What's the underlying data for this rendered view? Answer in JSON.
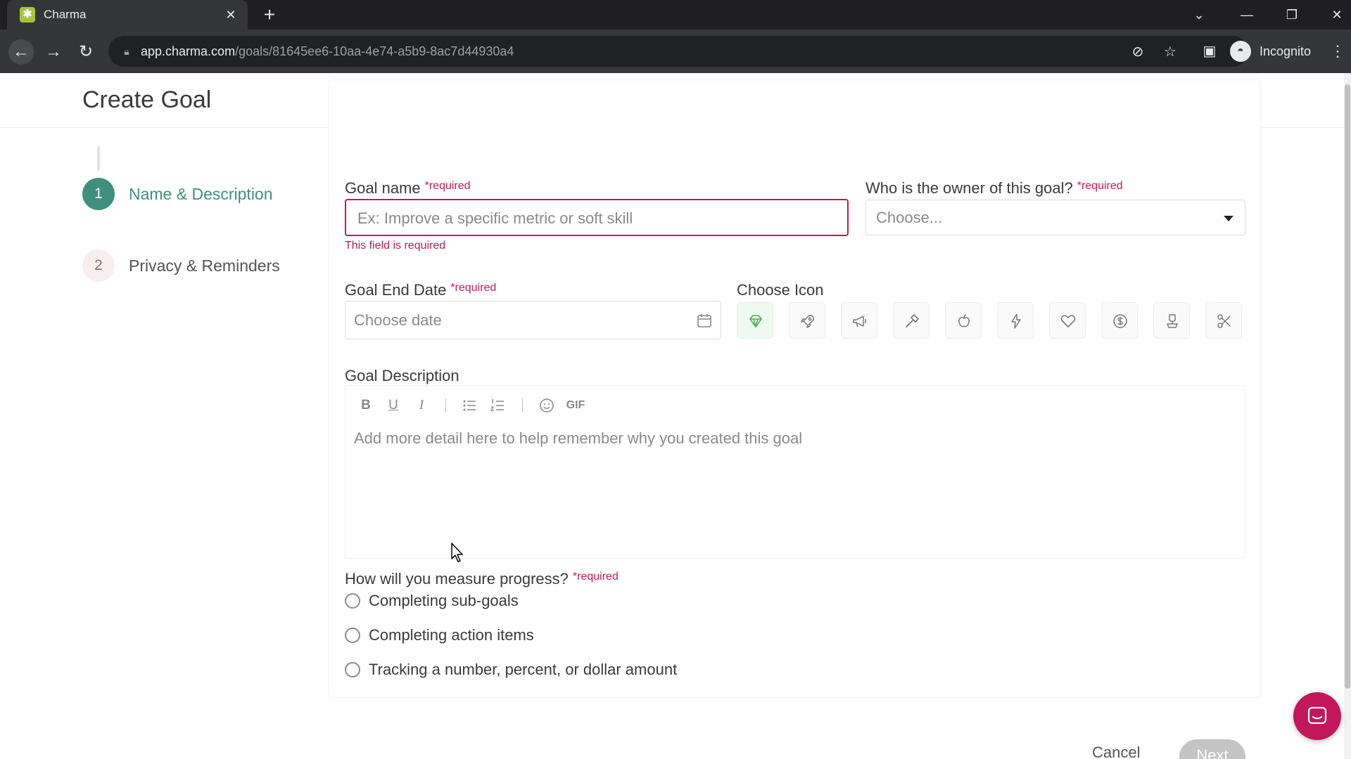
{
  "browser": {
    "tab_title": "Charma",
    "tab_favicon": "charma-favicon",
    "url_host": "app.charma.com",
    "url_path": "/goals/81645ee6-10aa-4e74-a5b9-8ac7d44930a4",
    "profile_label": "Incognito"
  },
  "page": {
    "title": "Create Goal"
  },
  "steps": [
    {
      "number": "1",
      "label": "Name & Description",
      "state": "active"
    },
    {
      "number": "2",
      "label": "Privacy & Reminders",
      "state": "inactive"
    }
  ],
  "form": {
    "required_marker": "*required",
    "goal_name": {
      "label": "Goal name",
      "placeholder": "Ex: Improve a specific metric or soft skill",
      "value": "",
      "error": "This field is required"
    },
    "owner": {
      "label": "Who is the owner of this goal?",
      "selected": "Choose..."
    },
    "end_date": {
      "label": "Goal End Date",
      "placeholder": "Choose date"
    },
    "icon_chooser": {
      "label": "Choose Icon",
      "icons": [
        "diamond-icon",
        "rocket-icon",
        "megaphone-icon",
        "hammer-icon",
        "apple-icon",
        "lightning-icon",
        "heart-icon",
        "dollar-icon",
        "award-icon",
        "scissors-icon"
      ],
      "selected_index": 0,
      "selected_color": "#4caf50"
    },
    "description": {
      "label": "Goal Description",
      "placeholder": "Add more detail here to help remember why you created this goal",
      "toolbar": {
        "bold": "B",
        "underline": "U",
        "italic": "I",
        "gif": "GIF"
      }
    },
    "measure": {
      "label": "How will you measure progress?",
      "options": [
        "Completing sub-goals",
        "Completing action items",
        "Tracking a number, percent, or dollar amount"
      ]
    }
  },
  "actions": {
    "cancel": "Cancel",
    "next": "Next"
  },
  "colors": {
    "accent": "#3f8f7e",
    "error": "#c2185b",
    "chat": "#c2185b"
  }
}
